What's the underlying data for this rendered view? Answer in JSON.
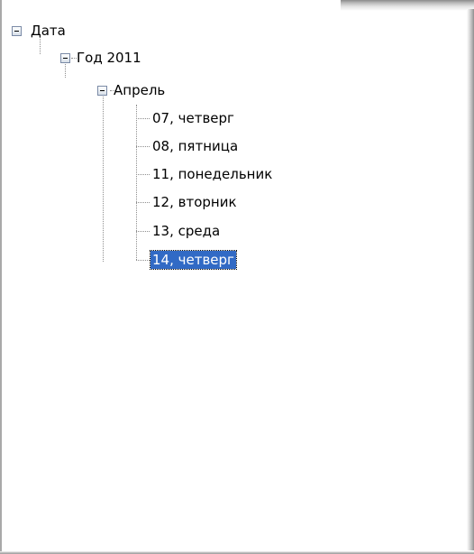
{
  "tree": {
    "root": {
      "label": "Дата",
      "expanded": true,
      "toggle_icon": "minus-box-icon"
    },
    "year": {
      "label": "Год 2011",
      "expanded": true,
      "toggle_icon": "minus-box-icon"
    },
    "month": {
      "label": "Апрель",
      "expanded": true,
      "toggle_icon": "minus-box-icon"
    },
    "days": [
      {
        "label": "07, четверг",
        "selected": false
      },
      {
        "label": "08, пятница",
        "selected": false
      },
      {
        "label": "11, понедельник",
        "selected": false
      },
      {
        "label": "12, вторник",
        "selected": false
      },
      {
        "label": "13, среда",
        "selected": false
      },
      {
        "label": "14, четверг",
        "selected": true
      }
    ]
  },
  "colors": {
    "selection_background": "#316ac5",
    "selection_text": "#ffffff",
    "tree_lines": "#8e8e8e"
  }
}
